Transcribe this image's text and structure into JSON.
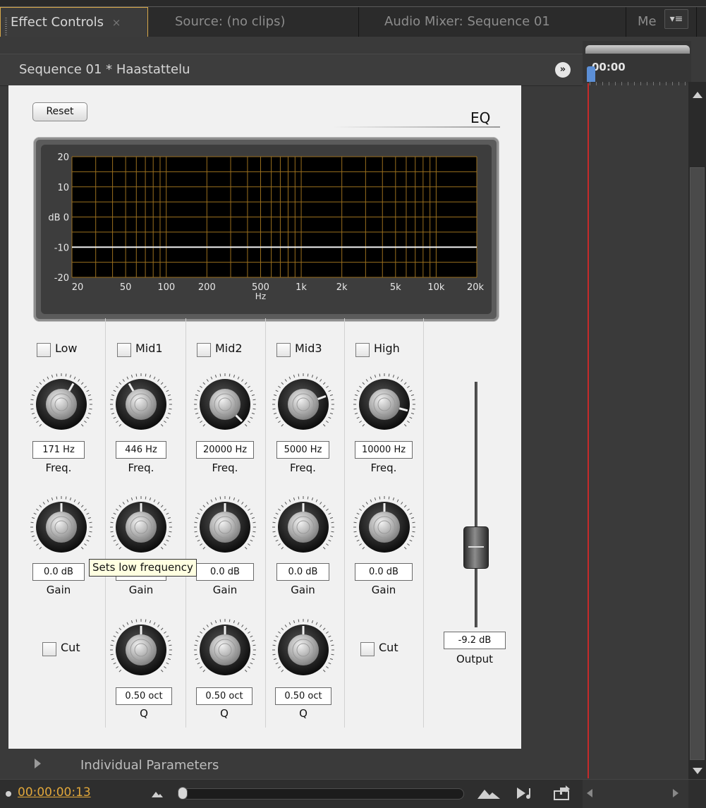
{
  "tabs": [
    {
      "label": "Effect Controls",
      "close": "×"
    },
    {
      "label": "Source: (no clips)"
    },
    {
      "label": "Audio Mixer: Sequence 01"
    },
    {
      "label": "Me"
    }
  ],
  "tab_menu_icon": "▾≡",
  "sequence_title": "Sequence 01 * Haastattelu",
  "sequence_nav_icon": "»",
  "eq": {
    "reset_label": "Reset",
    "title": "EQ",
    "graph": {
      "y_labels": [
        "20",
        "10",
        "dB 0",
        "-10",
        "-20"
      ],
      "x_labels": [
        "20",
        "50",
        "100",
        "200",
        "500",
        "1k",
        "2k",
        "5k",
        "10k",
        "20k"
      ],
      "x_unit": "Hz",
      "curve_db": -10
    },
    "bands": [
      {
        "name": "Low",
        "freq": "171 Hz",
        "freq_label": "Freq.",
        "gain": "0.0 dB",
        "gain_label": "Gain",
        "cut_label": "Cut",
        "freq_knob_angle": 30
      },
      {
        "name": "Mid1",
        "freq": "446 Hz",
        "freq_label": "Freq.",
        "gain": "0.0 dB",
        "gain_label": "Gain",
        "q": "0.50 oct",
        "q_label": "Q",
        "freq_knob_angle": -30
      },
      {
        "name": "Mid2",
        "freq": "20000 Hz",
        "freq_label": "Freq.",
        "gain": "0.0 dB",
        "gain_label": "Gain",
        "q": "0.50 oct",
        "q_label": "Q",
        "freq_knob_angle": 135
      },
      {
        "name": "Mid3",
        "freq": "5000 Hz",
        "freq_label": "Freq.",
        "gain": "0.0 dB",
        "gain_label": "Gain",
        "q": "0.50 oct",
        "q_label": "Q",
        "freq_knob_angle": 70
      },
      {
        "name": "High",
        "freq": "10000 Hz",
        "freq_label": "Freq.",
        "gain": "0.0 dB",
        "gain_label": "Gain",
        "cut_label": "Cut",
        "freq_knob_angle": 105
      }
    ],
    "output_value": "-9.2 dB",
    "output_label": "Output",
    "tooltip": "Sets low frequency"
  },
  "individual_parameters": "Individual Parameters",
  "status": {
    "timecode": "00:00:00:13",
    "icons": [
      "zoom-out-icon",
      "zoom-in-icon",
      "play-audio-icon",
      "export-icon"
    ]
  },
  "timeline": {
    "ruler_time": "00:00"
  }
}
